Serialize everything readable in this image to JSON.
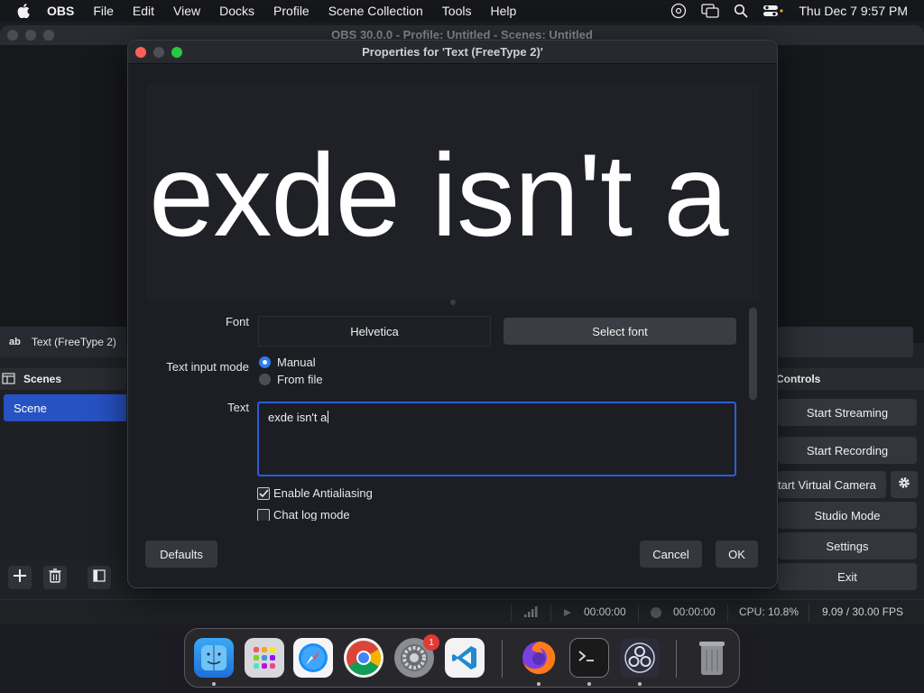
{
  "menubar": {
    "app_name": "OBS",
    "items": [
      "File",
      "Edit",
      "View",
      "Docks",
      "Profile",
      "Scene Collection",
      "Tools",
      "Help"
    ],
    "datetime": "Thu Dec 7  9:57 PM"
  },
  "obs": {
    "window_title": "OBS 30.0.0 - Profile: Untitled - Scenes: Untitled",
    "source_name": "Text (FreeType 2)",
    "source_icon_text": "ab",
    "scenes_header": "Scenes",
    "scenes": [
      "Scene"
    ],
    "controls_header": "Controls",
    "controls": [
      "Start Streaming",
      "Start Recording",
      "tart Virtual Camera",
      "Studio Mode",
      "Settings",
      "Exit"
    ],
    "status": {
      "stream_time": "00:00:00",
      "record_time": "00:00:00",
      "cpu": "CPU: 10.8%",
      "fps": "9.09 / 30.00 FPS"
    }
  },
  "dialog": {
    "title": "Properties for 'Text (FreeType 2)'",
    "preview_text": "exde isn't a",
    "font_label": "Font",
    "font_value": "Helvetica",
    "select_font_label": "Select font",
    "text_input_mode_label": "Text input mode",
    "input_modes": [
      "Manual",
      "From file"
    ],
    "selected_input_mode": "Manual",
    "text_label": "Text",
    "text_value": "exde isn't a",
    "antialiasing_label": "Enable Antialiasing",
    "antialiasing_checked": true,
    "chat_log_label": "Chat log mode",
    "chat_log_checked": false,
    "defaults_label": "Defaults",
    "cancel_label": "Cancel",
    "ok_label": "OK"
  },
  "dock": {
    "apps": [
      "finder-icon",
      "launchpad-icon",
      "safari-icon",
      "chrome-icon",
      "system-settings-icon",
      "vscode-icon",
      "firefox-icon",
      "terminal-icon",
      "obs-icon",
      "trash-icon"
    ],
    "settings_badge": "1"
  },
  "colors": {
    "accent": "#2752c4",
    "text_area_border": "#2b5cd9",
    "radio_on": "#2f7bf5"
  }
}
